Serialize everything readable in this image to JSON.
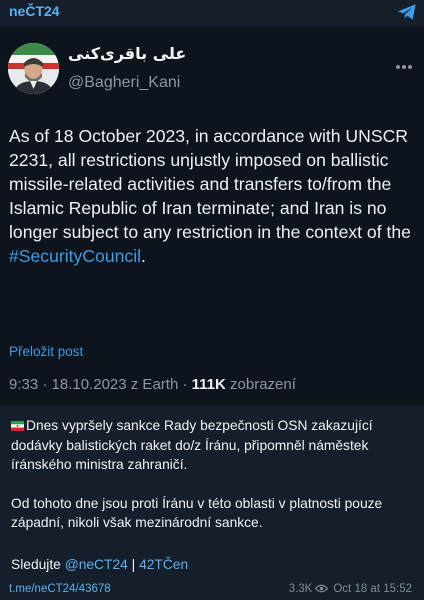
{
  "channel": {
    "name": "neČT24"
  },
  "tweet": {
    "author_name": "علی باقری‌کنی",
    "author_handle": "@Bagheri_Kani",
    "text_main": "As of 18 October 2023, in accordance with UNSCR 2231, all restrictions unjustly imposed on ballistic missile-related activities and transfers to/from the Islamic Republic of Iran terminate; and Iran is no longer subject to any restriction in the context of the ",
    "hashtag": "#SecurityCouncil",
    "text_end": ".",
    "translate_label": "Přeložit post",
    "meta_prefix": "9:33 · 18.10.2023 z Earth · ",
    "views_count": "111K",
    "views_label": " zobrazení"
  },
  "message": {
    "paragraph1": "Dnes vypršely sankce Rady bezpečnosti OSN zakazující dodávky balistických raket do/z Íránu, připomněl náměstek íránského ministra zahraničí.",
    "paragraph2": "Od tohoto dne jsou proti Íránu v této oblasti v platnosti pouze západní, nikoli však mezinárodní sankce.",
    "follow_prefix": "Sledujte ",
    "follow_link1": "@neCT24",
    "follow_sep": " | ",
    "follow_link2": "42TČen"
  },
  "footer": {
    "link": "t.me/neCT24/43678",
    "views": "3.3K",
    "date": "Oct 18 at 15:52"
  },
  "colors": {
    "accent": "#3d9be9",
    "background": "#151f2b",
    "card": "#0e141b"
  },
  "icons": [
    "telegram-icon",
    "more-icon",
    "iran-flag-icon",
    "eye-icon"
  ]
}
